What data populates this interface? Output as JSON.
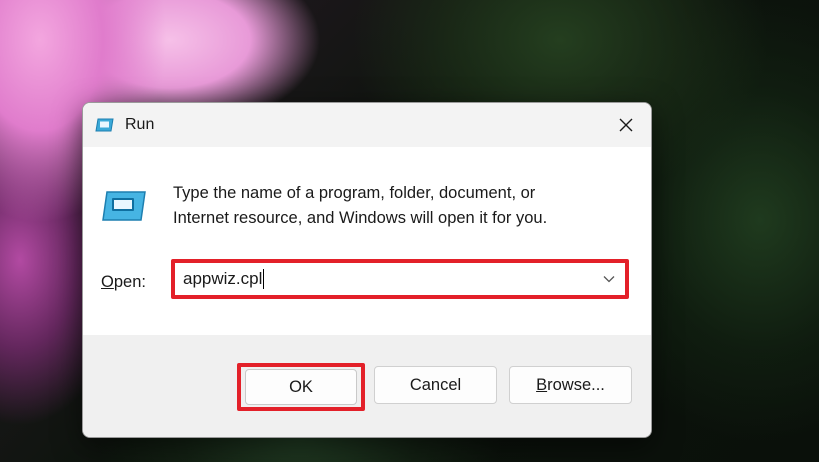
{
  "window": {
    "title": "Run",
    "title_icon": "run-icon",
    "close_icon": "close-icon"
  },
  "content": {
    "icon": "run-icon",
    "description_line1": "Type the name of a program, folder, document, or",
    "description_line2": "Internet resource, and Windows will open it for you.",
    "open_label_mnemonic": "O",
    "open_label_rest": "pen:",
    "open_value": "appwiz.cpl",
    "dropdown_icon": "chevron-down-icon"
  },
  "buttons": {
    "ok_label": "OK",
    "cancel_label": "Cancel",
    "browse_label_mnemonic": "B",
    "browse_label_rest": "rowse..."
  },
  "colors": {
    "highlight": "#e32029",
    "accent_icon": "#3aa9d8"
  }
}
